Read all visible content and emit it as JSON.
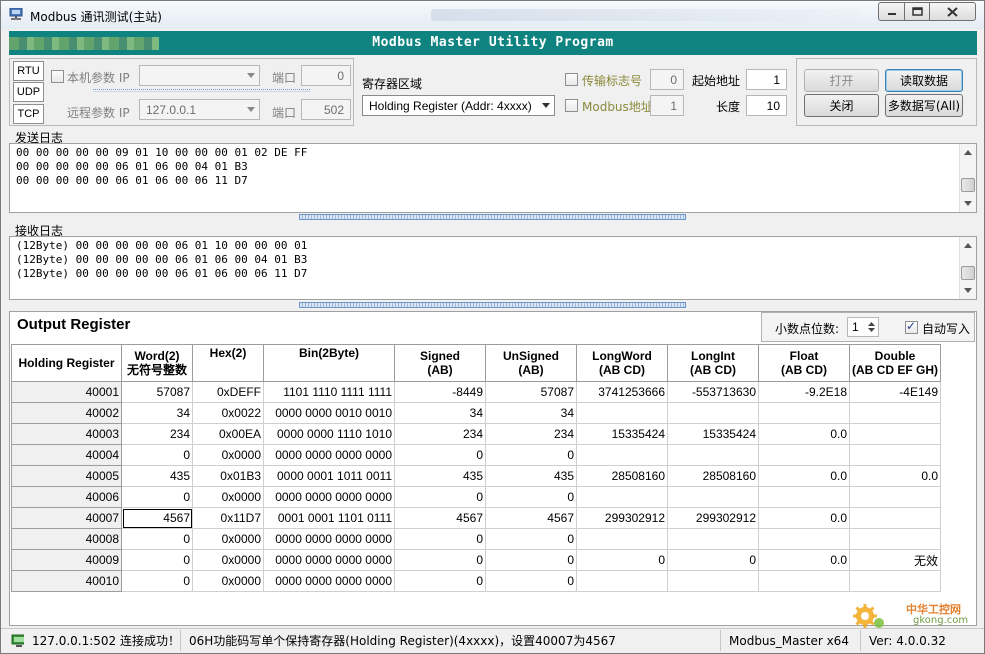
{
  "window": {
    "title": "Modbus 通讯测试(主站)"
  },
  "banner": {
    "title": "Modbus Master Utility Program"
  },
  "protocols": [
    "RTU",
    "UDP",
    "TCP"
  ],
  "local": {
    "label": "本机参数 IP",
    "ip": "",
    "port_label": "端口",
    "port": "0"
  },
  "remote": {
    "label": "远程参数 IP",
    "ip": "127.0.0.1",
    "port_label": "端口",
    "port": "502"
  },
  "register_area": {
    "label": "寄存器区域",
    "selected": "Holding Register (Addr: 4xxxx)"
  },
  "transfer_flag": {
    "label": "传输标志号",
    "value": "0"
  },
  "modbus_addr": {
    "label": "Modbus地址",
    "value": "1"
  },
  "start_addr": {
    "label": "起始地址",
    "value": "1"
  },
  "length": {
    "label": "长度",
    "value": "10"
  },
  "buttons": {
    "open": "打开",
    "close": "关闭",
    "read": "读取数据",
    "multi_write": "多数据写(All)"
  },
  "send_log": {
    "label": "发送日志",
    "lines": [
      "00 00 00 00 00 09 01 10 00 00 00 01 02 DE FF",
      "00 00 00 00 00 06 01 06 00 04 01 B3",
      "00 00 00 00 00 06 01 06 00 06 11 D7"
    ]
  },
  "recv_log": {
    "label": "接收日志",
    "lines": [
      "(12Byte) 00 00 00 00 00 06 01 10 00 00 00 01",
      "(12Byte) 00 00 00 00 00 06 01 06 00 04 01 B3",
      "(12Byte) 00 00 00 00 00 06 01 06 00 06 11 D7"
    ]
  },
  "output": {
    "title": "Output Register",
    "decimal_label": "小数点位数:",
    "decimal_value": "1",
    "auto_write_label": "自动写入",
    "auto_write": true,
    "columns": [
      [
        "Holding Register"
      ],
      [
        "Word(2)",
        "无符号整数"
      ],
      [
        "Hex(2)"
      ],
      [
        "Bin(2Byte)"
      ],
      [
        "Signed",
        "(AB)"
      ],
      [
        "UnSigned",
        "(AB)"
      ],
      [
        "LongWord",
        "(AB CD)"
      ],
      [
        "LongInt",
        "(AB CD)"
      ],
      [
        "Float",
        "(AB CD)"
      ],
      [
        "Double",
        "(AB CD EF GH)"
      ]
    ],
    "rows": [
      [
        "40001",
        "57087",
        "0xDEFF",
        "1101 1110 1111 1111",
        "-8449",
        "57087",
        "3741253666",
        "-553713630",
        "-9.2E18",
        "-4E149"
      ],
      [
        "40002",
        "34",
        "0x0022",
        "0000 0000 0010 0010",
        "34",
        "34",
        "",
        "",
        "",
        ""
      ],
      [
        "40003",
        "234",
        "0x00EA",
        "0000 0000 1110 1010",
        "234",
        "234",
        "15335424",
        "15335424",
        "0.0",
        ""
      ],
      [
        "40004",
        "0",
        "0x0000",
        "0000 0000 0000 0000",
        "0",
        "0",
        "",
        "",
        "",
        ""
      ],
      [
        "40005",
        "435",
        "0x01B3",
        "0000 0001 1011 0011",
        "435",
        "435",
        "28508160",
        "28508160",
        "0.0",
        "0.0"
      ],
      [
        "40006",
        "0",
        "0x0000",
        "0000 0000 0000 0000",
        "0",
        "0",
        "",
        "",
        "",
        ""
      ],
      [
        "40007",
        "4567",
        "0x11D7",
        "0001 0001 1101 0111",
        "4567",
        "4567",
        "299302912",
        "299302912",
        "0.0",
        ""
      ],
      [
        "40008",
        "0",
        "0x0000",
        "0000 0000 0000 0000",
        "0",
        "0",
        "",
        "",
        "",
        ""
      ],
      [
        "40009",
        "0",
        "0x0000",
        "0000 0000 0000 0000",
        "0",
        "0",
        "0",
        "0",
        "0.0",
        "无效"
      ],
      [
        "40010",
        "0",
        "0x0000",
        "0000 0000 0000 0000",
        "0",
        "0",
        "",
        "",
        "",
        ""
      ]
    ]
  },
  "status": {
    "connection": "127.0.0.1:502 连接成功！",
    "message": "06H功能码写单个保持寄存器(Holding Register)(4xxxx)，设置40007为4567",
    "app": "Modbus_Master x64",
    "version": "Ver: 4.0.0.32"
  },
  "watermark": {
    "text": "中华工控网",
    "url": "gkong.com"
  }
}
